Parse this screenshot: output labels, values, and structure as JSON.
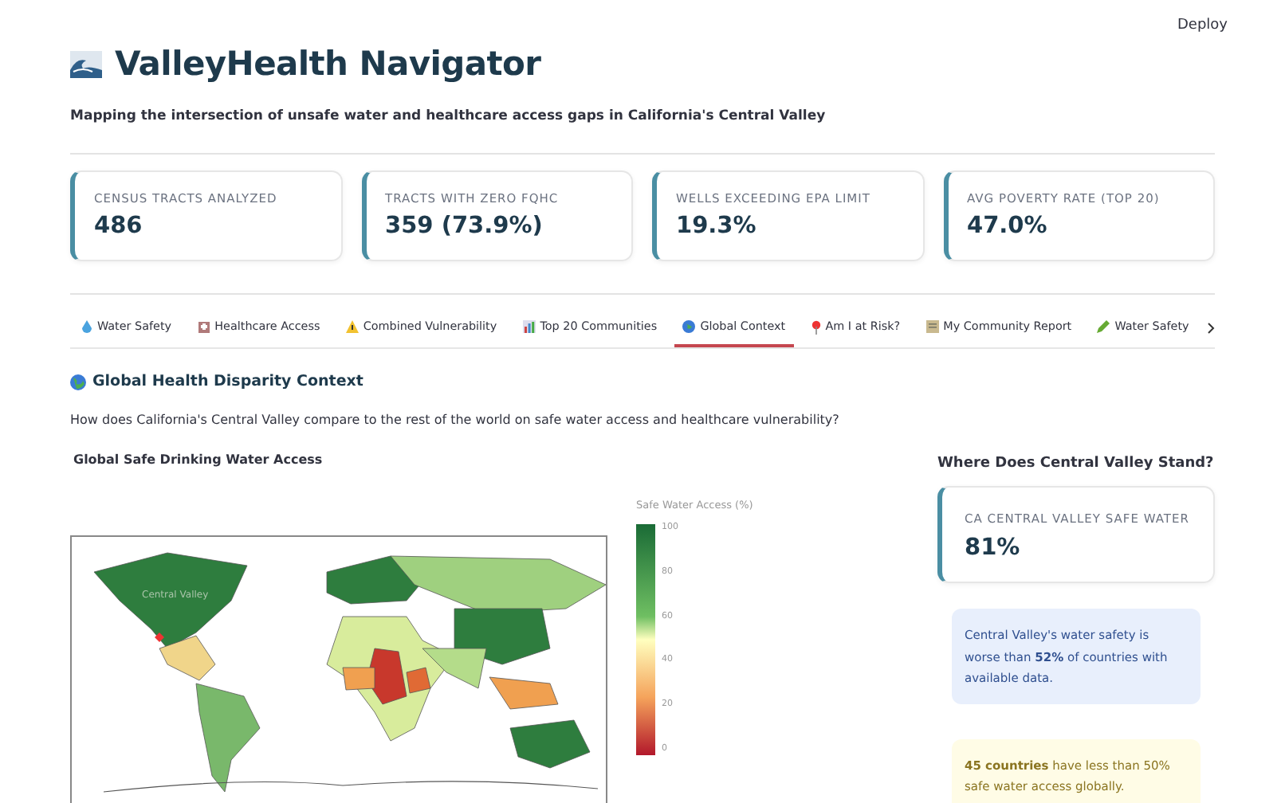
{
  "header": {
    "deploy": "Deploy",
    "title": "ValleyHealth Navigator",
    "subtitle": "Mapping the intersection of unsafe water and healthcare access gaps in California's Central Valley"
  },
  "metrics": [
    {
      "label": "CENSUS TRACTS ANALYZED",
      "value": "486"
    },
    {
      "label": "TRACTS WITH ZERO FQHC",
      "value": "359 (73.9%)"
    },
    {
      "label": "WELLS EXCEEDING EPA LIMIT",
      "value": "19.3%"
    },
    {
      "label": "AVG POVERTY RATE (TOP 20)",
      "value": "47.0%"
    }
  ],
  "tabs": [
    {
      "label": "Water Safety",
      "selected": false
    },
    {
      "label": "Healthcare Access",
      "selected": false
    },
    {
      "label": "Combined Vulnerability",
      "selected": false
    },
    {
      "label": "Top 20 Communities",
      "selected": false
    },
    {
      "label": "Global Context",
      "selected": true
    },
    {
      "label": "Am I at Risk?",
      "selected": false
    },
    {
      "label": "My Community Report",
      "selected": false
    },
    {
      "label": "Water Safety",
      "selected": false
    }
  ],
  "section": {
    "heading": "Global Health Disparity Context",
    "question": "How does California's Central Valley compare to the rest of the world on safe water access and healthcare vulnerability?"
  },
  "map": {
    "title": "Global Safe Drinking Water Access",
    "marker_label": "Central Valley",
    "colorbar": {
      "title": "Safe Water Access (%)",
      "ticks": [
        "100",
        "80",
        "60",
        "40",
        "20",
        "0"
      ]
    }
  },
  "standing": {
    "heading": "Where Does Central Valley Stand?",
    "metric": {
      "label": "CA CENTRAL VALLEY SAFE WATER",
      "value": "81%"
    },
    "info": "Central Valley's water safety is worse than **52%** of countries with available data.",
    "warning": "**45 countries** have less than 50% safe water access globally."
  }
}
